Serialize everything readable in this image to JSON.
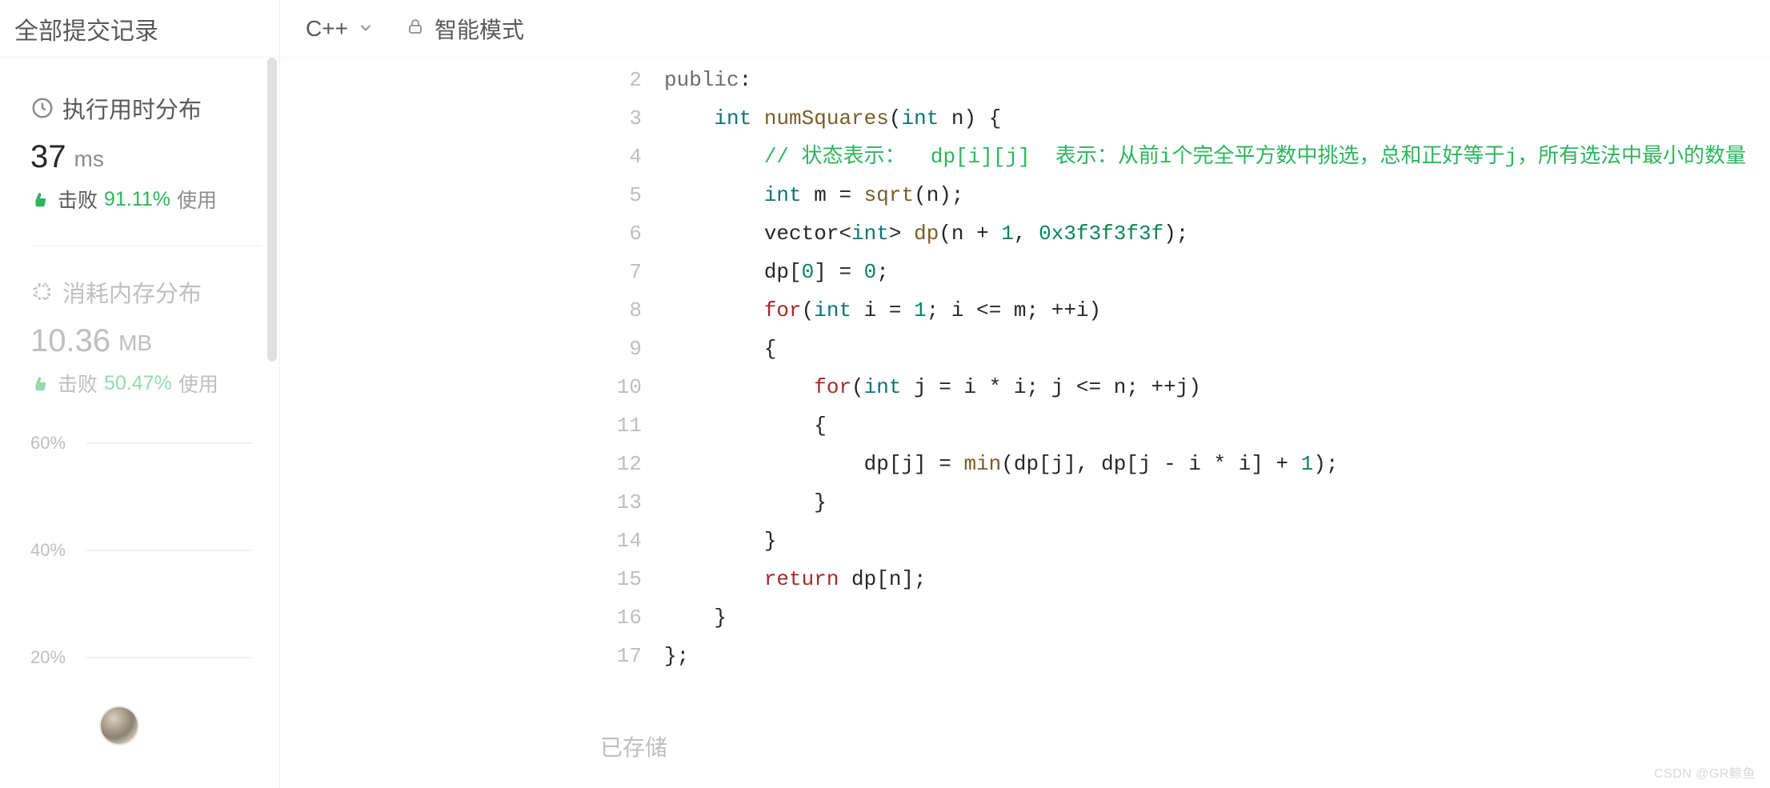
{
  "sidebar": {
    "header": "全部提交记录",
    "runtime": {
      "title": "执行用时分布",
      "value": "37",
      "unit": "ms",
      "beat_label": "击败",
      "beat_pct": "91.11%",
      "beat_suffix": "使用"
    },
    "memory": {
      "title": "消耗内存分布",
      "value": "10.36",
      "unit": "MB",
      "beat_label": "击败",
      "beat_pct": "50.47%",
      "beat_suffix": "使用"
    },
    "chart": {
      "y60": "60%",
      "y40": "40%",
      "y20": "20%"
    }
  },
  "main": {
    "language": "C++",
    "mode": "智能模式",
    "saved": "已存储",
    "watermark": "CSDN @GR鲸鱼"
  },
  "code": {
    "start_line": 2,
    "lines": [
      {
        "n": 2,
        "indent": "",
        "tokens": [
          {
            "t": "public",
            "c": "kw-gray"
          },
          {
            "t": ":",
            "c": ""
          }
        ]
      },
      {
        "n": 3,
        "indent": "    ",
        "tokens": [
          {
            "t": "int ",
            "c": "kw-teal"
          },
          {
            "t": "numSquares",
            "c": "fn"
          },
          {
            "t": "(",
            "c": ""
          },
          {
            "t": "int ",
            "c": "kw-teal"
          },
          {
            "t": "n",
            "c": ""
          },
          {
            "t": ") {",
            "c": ""
          }
        ]
      },
      {
        "n": 4,
        "indent": "        ",
        "tokens": [
          {
            "t": "// 状态表示：  dp[i][j]  表示：从前i个完全平方数中挑选，总和正好等于j，所有选法中最小的数量",
            "c": "cmt"
          }
        ]
      },
      {
        "n": 5,
        "indent": "        ",
        "tokens": [
          {
            "t": "int ",
            "c": "kw-teal"
          },
          {
            "t": "m = ",
            "c": ""
          },
          {
            "t": "sqrt",
            "c": "fn"
          },
          {
            "t": "(n);",
            "c": ""
          }
        ]
      },
      {
        "n": 6,
        "indent": "        ",
        "tokens": [
          {
            "t": "vector",
            "c": ""
          },
          {
            "t": "<",
            "c": ""
          },
          {
            "t": "int",
            "c": "kw-teal"
          },
          {
            "t": "> ",
            "c": ""
          },
          {
            "t": "dp",
            "c": "fn"
          },
          {
            "t": "(n + ",
            "c": ""
          },
          {
            "t": "1",
            "c": "num"
          },
          {
            "t": ", ",
            "c": ""
          },
          {
            "t": "0x3f3f3f3f",
            "c": "num"
          },
          {
            "t": ");",
            "c": ""
          }
        ]
      },
      {
        "n": 7,
        "indent": "        ",
        "tokens": [
          {
            "t": "dp[",
            "c": ""
          },
          {
            "t": "0",
            "c": "num"
          },
          {
            "t": "] = ",
            "c": ""
          },
          {
            "t": "0",
            "c": "num"
          },
          {
            "t": ";",
            "c": ""
          }
        ]
      },
      {
        "n": 8,
        "indent": "        ",
        "tokens": [
          {
            "t": "for",
            "c": "kw-red"
          },
          {
            "t": "(",
            "c": ""
          },
          {
            "t": "int ",
            "c": "kw-teal"
          },
          {
            "t": "i = ",
            "c": ""
          },
          {
            "t": "1",
            "c": "num"
          },
          {
            "t": "; i <= m; ++i)",
            "c": ""
          }
        ]
      },
      {
        "n": 9,
        "indent": "        ",
        "tokens": [
          {
            "t": "{",
            "c": "brace"
          }
        ]
      },
      {
        "n": 10,
        "indent": "            ",
        "tokens": [
          {
            "t": "for",
            "c": "kw-red"
          },
          {
            "t": "(",
            "c": ""
          },
          {
            "t": "int ",
            "c": "kw-teal"
          },
          {
            "t": "j = i * i; j <= n; ++j)",
            "c": ""
          }
        ]
      },
      {
        "n": 11,
        "indent": "            ",
        "tokens": [
          {
            "t": "{",
            "c": "brace"
          }
        ]
      },
      {
        "n": 12,
        "indent": "                ",
        "tokens": [
          {
            "t": "dp[j] = ",
            "c": ""
          },
          {
            "t": "min",
            "c": "fn"
          },
          {
            "t": "(dp[j], dp[j - i * i] + ",
            "c": ""
          },
          {
            "t": "1",
            "c": "num"
          },
          {
            "t": ");",
            "c": ""
          }
        ]
      },
      {
        "n": 13,
        "indent": "            ",
        "tokens": [
          {
            "t": "}",
            "c": "brace"
          }
        ]
      },
      {
        "n": 14,
        "indent": "        ",
        "tokens": [
          {
            "t": "}",
            "c": "brace"
          }
        ]
      },
      {
        "n": 15,
        "indent": "        ",
        "tokens": [
          {
            "t": "return ",
            "c": "kw-red"
          },
          {
            "t": "dp[n];",
            "c": ""
          }
        ]
      },
      {
        "n": 16,
        "indent": "    ",
        "tokens": [
          {
            "t": "}",
            "c": "brace"
          }
        ]
      },
      {
        "n": 17,
        "indent": "",
        "tokens": [
          {
            "t": "};",
            "c": "brace"
          }
        ]
      }
    ]
  },
  "chart_data": {
    "type": "bar",
    "title": "执行用时分布 / 消耗内存分布",
    "y_ticks": [
      "60%",
      "40%",
      "20%"
    ],
    "ylim": [
      0,
      60
    ],
    "categories": [],
    "values": []
  }
}
